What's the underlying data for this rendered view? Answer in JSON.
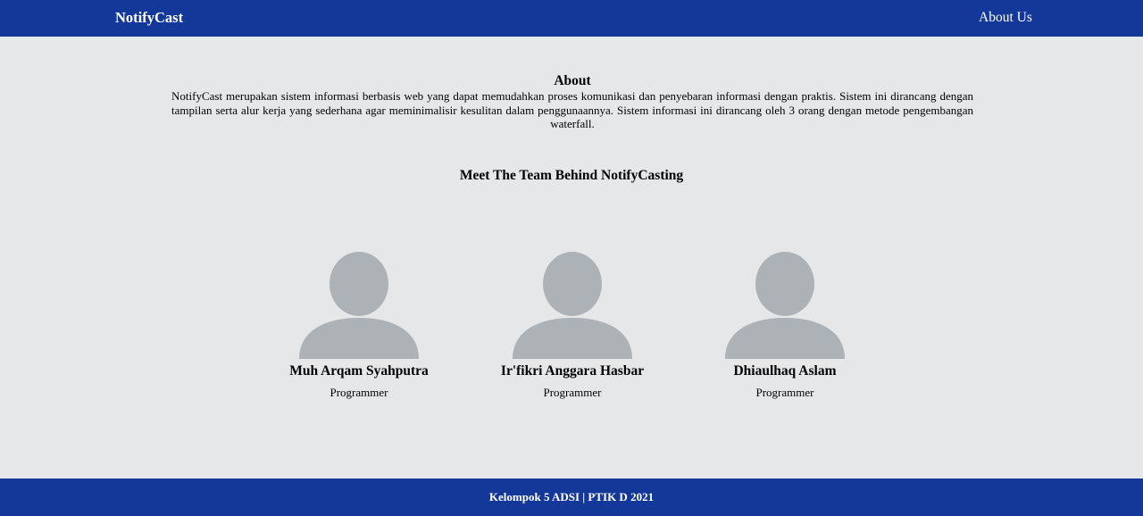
{
  "navbar": {
    "brand": "NotifyCast",
    "link": "About Us",
    "color": "#14389a"
  },
  "about": {
    "title": "About",
    "text": "NotifyCast merupakan sistem informasi berbasis web yang dapat memudahkan proses komunikasi dan penyebaran informasi dengan praktis. Sistem ini dirancang dengan tampilan serta alur kerja yang sederhana agar meminimalisir kesulitan dalam penggunaannya. Sistem informasi ini dirancang oleh 3 orang dengan metode pengembangan waterfall."
  },
  "team": {
    "title": "Meet The Team Behind NotifyCasting",
    "members": [
      {
        "name": "Muh Arqam Syahputra",
        "role": "Programmer",
        "icon": "user-avatar-icon"
      },
      {
        "name": "Ir'fikri Anggara Hasbar",
        "role": "Programmer",
        "icon": "user-avatar-icon"
      },
      {
        "name": "Dhiaulhaq Aslam",
        "role": "Programmer",
        "icon": "user-avatar-icon"
      }
    ]
  },
  "footer": {
    "text": "Kelompok 5 ADSI | PTIK D 2021"
  }
}
